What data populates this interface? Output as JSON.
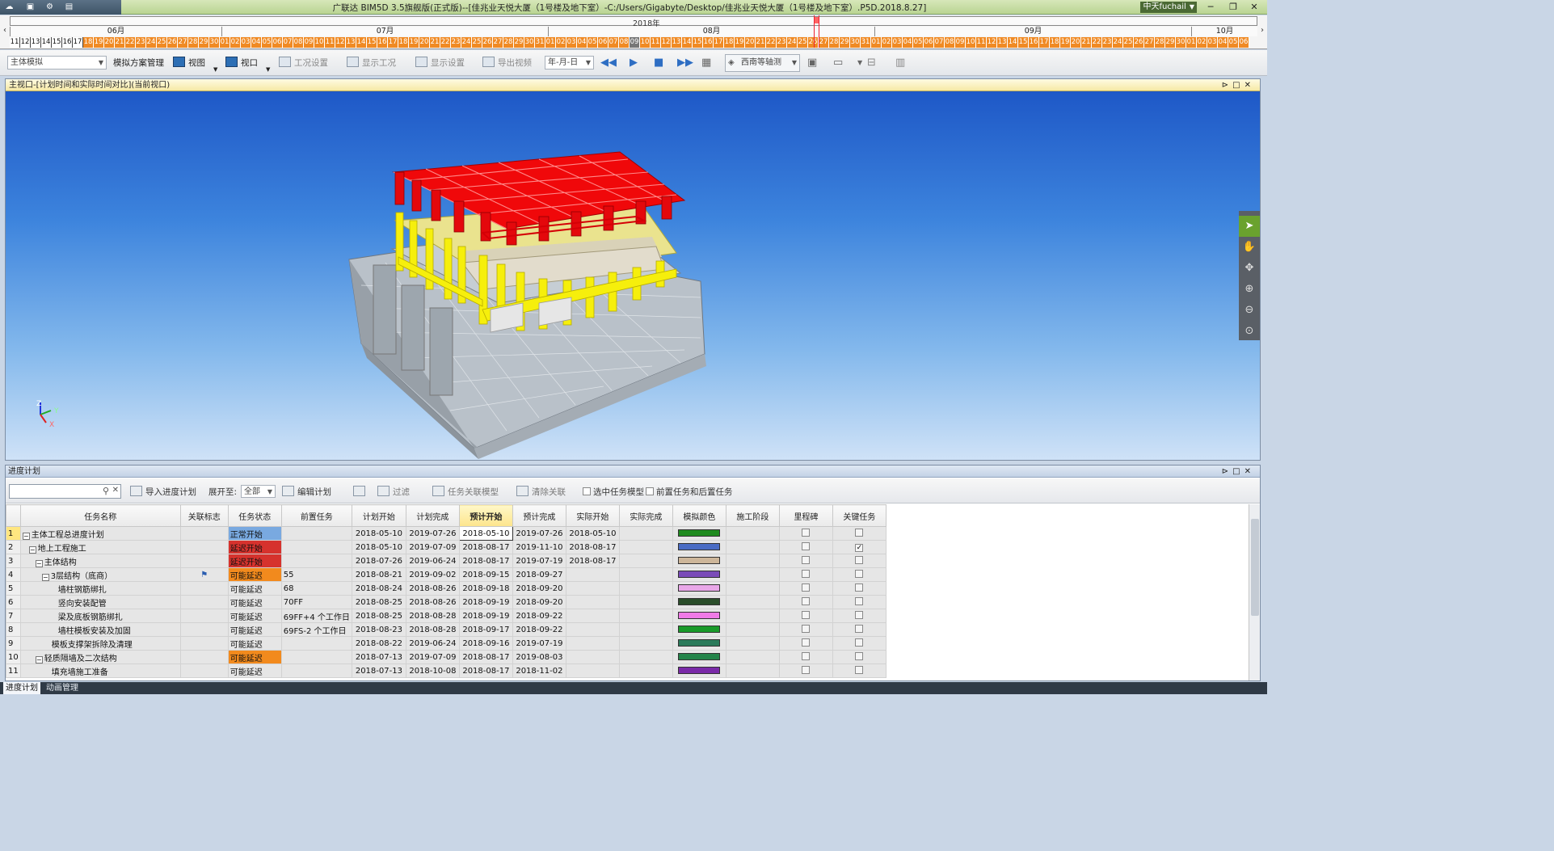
{
  "window": {
    "title": "广联达 BIM5D 3.5旗舰版(正式版)--[佳兆业天悦大厦（1号楼及地下室）-C:/Users/Gigabyte/Desktop/佳兆业天悦大厦（1号楼及地下室）.P5D.2018.8.27]",
    "user": "中天fuchail",
    "minimize": "─",
    "restore": "❐",
    "close": "✕"
  },
  "timeline": {
    "year": "2018年",
    "months": [
      "06月",
      "07月",
      "08月",
      "09月",
      "10月"
    ],
    "days_june_past": [
      "11",
      "12",
      "13",
      "14",
      "15",
      "16",
      "17"
    ],
    "days": [
      "18",
      "19",
      "20",
      "21",
      "22",
      "23",
      "24",
      "25",
      "26",
      "27",
      "28",
      "29",
      "30",
      "01",
      "02",
      "03",
      "04",
      "05",
      "06",
      "07",
      "08",
      "09",
      "10",
      "11",
      "12",
      "13",
      "14",
      "15",
      "16",
      "17",
      "18",
      "19",
      "20",
      "21",
      "22",
      "23",
      "24",
      "25",
      "26",
      "27",
      "28",
      "29",
      "30",
      "31",
      "01",
      "02",
      "03",
      "04",
      "05",
      "06",
      "07",
      "08",
      "09",
      "10",
      "11",
      "12",
      "13",
      "14",
      "15",
      "16",
      "17",
      "18",
      "19",
      "20",
      "21",
      "22",
      "23",
      "24",
      "25",
      "26",
      "27",
      "28",
      "29",
      "30",
      "31",
      "01",
      "02",
      "03",
      "04",
      "05",
      "06",
      "07",
      "08",
      "09",
      "10",
      "11",
      "12",
      "13",
      "14",
      "15",
      "16",
      "17",
      "18",
      "19",
      "20",
      "21",
      "22",
      "23",
      "24",
      "25",
      "26",
      "27",
      "28",
      "29",
      "30",
      "01",
      "02",
      "03",
      "04",
      "05",
      "06"
    ],
    "current_day_index": 52,
    "left_arrow": "‹",
    "right_arrow": "›"
  },
  "toolbar": {
    "mode_combo": "主体模拟",
    "plan_manage": "模拟方案管理",
    "view": "视图",
    "viewport": "视口",
    "condition_settings": "工况设置",
    "show_condition": "显示工况",
    "display_settings": "显示设置",
    "export_video": "导出视频",
    "date_format": "年-月-日",
    "axis_view": "西南等轴测"
  },
  "main_view": {
    "title": "主视口-[计划时间和实际时间对比](当前视口)"
  },
  "schedule": {
    "title": "进度计划",
    "search_placeholder": "",
    "import_plan": "导入进度计划",
    "expand_to_label": "展开至:",
    "expand_to_value": "全部",
    "edit_plan": "编辑计划",
    "filter": "过滤",
    "link_model": "任务关联模型",
    "clear_link": "清除关联",
    "select_model": "选中任务模型",
    "pre_post": "前置任务和后置任务",
    "columns": [
      "任务名称",
      "关联标志",
      "任务状态",
      "前置任务",
      "计划开始",
      "计划完成",
      "预计开始",
      "预计完成",
      "实际开始",
      "实际完成",
      "模拟颜色",
      "施工阶段",
      "里程碑",
      "关键任务"
    ],
    "rows": [
      {
        "n": "1",
        "name": "主体工程总进度计划",
        "level": 0,
        "exp": "−",
        "flag": "",
        "status": "正常开始",
        "status_color": "#79a9e0",
        "pre": "",
        "ps": "2018-05-10",
        "pf": "2019-07-26",
        "es": "2018-05-10",
        "ef": "2019-07-26",
        "as": "2018-05-10",
        "af": "",
        "color": "#1e8a1e",
        "key": false
      },
      {
        "n": "2",
        "name": "地上工程施工",
        "level": 1,
        "exp": "−",
        "flag": "",
        "status": "延迟开始",
        "status_color": "#d6322d",
        "pre": "",
        "ps": "2018-05-10",
        "pf": "2019-07-09",
        "es": "2018-08-17",
        "ef": "2019-11-10",
        "as": "2018-08-17",
        "af": "",
        "color": "#4a6cc4",
        "key": true
      },
      {
        "n": "3",
        "name": "主体结构",
        "level": 2,
        "exp": "−",
        "flag": "",
        "status": "延迟开始",
        "status_color": "#d6322d",
        "pre": "",
        "ps": "2018-07-26",
        "pf": "2019-06-24",
        "es": "2018-08-17",
        "ef": "2019-07-19",
        "as": "2018-08-17",
        "af": "",
        "color": "#cdb69a",
        "key": false
      },
      {
        "n": "4",
        "name": "3层结构（底商）",
        "level": 3,
        "exp": "−",
        "flag": "⚑",
        "status": "可能延迟",
        "status_color": "#f28a1d",
        "pre": "55",
        "ps": "2018-08-21",
        "pf": "2019-09-02",
        "es": "2018-09-15",
        "ef": "2018-09-27",
        "as": "",
        "af": "",
        "color": "#7a4bb8",
        "key": false
      },
      {
        "n": "5",
        "name": "墙柱钢筋绑扎",
        "level": 4,
        "exp": "",
        "flag": "",
        "status": "可能延迟",
        "status_color": "",
        "pre": "68",
        "ps": "2018-08-24",
        "pf": "2018-08-26",
        "es": "2018-09-18",
        "ef": "2018-09-20",
        "as": "",
        "af": "",
        "color": "#e9a7e8",
        "key": false
      },
      {
        "n": "6",
        "name": "竖向安装配管",
        "level": 4,
        "exp": "",
        "flag": "",
        "status": "可能延迟",
        "status_color": "",
        "pre": "70FF",
        "ps": "2018-08-25",
        "pf": "2018-08-26",
        "es": "2018-09-19",
        "ef": "2018-09-20",
        "as": "",
        "af": "",
        "color": "#2a4d2a",
        "key": false
      },
      {
        "n": "7",
        "name": "梁及底板钢筋绑扎",
        "level": 4,
        "exp": "",
        "flag": "",
        "status": "可能延迟",
        "status_color": "",
        "pre": "69FF+4 个工作日",
        "ps": "2018-08-25",
        "pf": "2018-08-28",
        "es": "2018-09-19",
        "ef": "2018-09-22",
        "as": "",
        "af": "",
        "color": "#f07be6",
        "key": false
      },
      {
        "n": "8",
        "name": "墙柱模板安装及加固",
        "level": 4,
        "exp": "",
        "flag": "",
        "status": "可能延迟",
        "status_color": "",
        "pre": "69FS-2 个工作日",
        "ps": "2018-08-23",
        "pf": "2018-08-28",
        "es": "2018-09-17",
        "ef": "2018-09-22",
        "as": "",
        "af": "",
        "color": "#1a9a2a",
        "key": false
      },
      {
        "n": "9",
        "name": "模板支撑架拆除及清理",
        "level": 3,
        "exp": "",
        "flag": "",
        "status": "可能延迟",
        "status_color": "",
        "pre": "",
        "ps": "2018-08-22",
        "pf": "2019-06-24",
        "es": "2018-09-16",
        "ef": "2019-07-19",
        "as": "",
        "af": "",
        "color": "#2a7a5a",
        "key": false
      },
      {
        "n": "10",
        "name": "轻质隔墙及二次结构",
        "level": 2,
        "exp": "−",
        "flag": "",
        "status": "可能延迟",
        "status_color": "#f28a1d",
        "pre": "",
        "ps": "2018-07-13",
        "pf": "2019-07-09",
        "es": "2018-08-17",
        "ef": "2019-08-03",
        "as": "",
        "af": "",
        "color": "#24844a",
        "key": false
      },
      {
        "n": "11",
        "name": "填充墙施工准备",
        "level": 3,
        "exp": "",
        "flag": "",
        "status": "可能延迟",
        "status_color": "",
        "pre": "",
        "ps": "2018-07-13",
        "pf": "2018-10-08",
        "es": "2018-08-17",
        "ef": "2018-11-02",
        "as": "",
        "af": "",
        "color": "#7a2aa8",
        "key": false
      }
    ]
  },
  "bottom_tabs": [
    "进度计划",
    "动画管理"
  ]
}
